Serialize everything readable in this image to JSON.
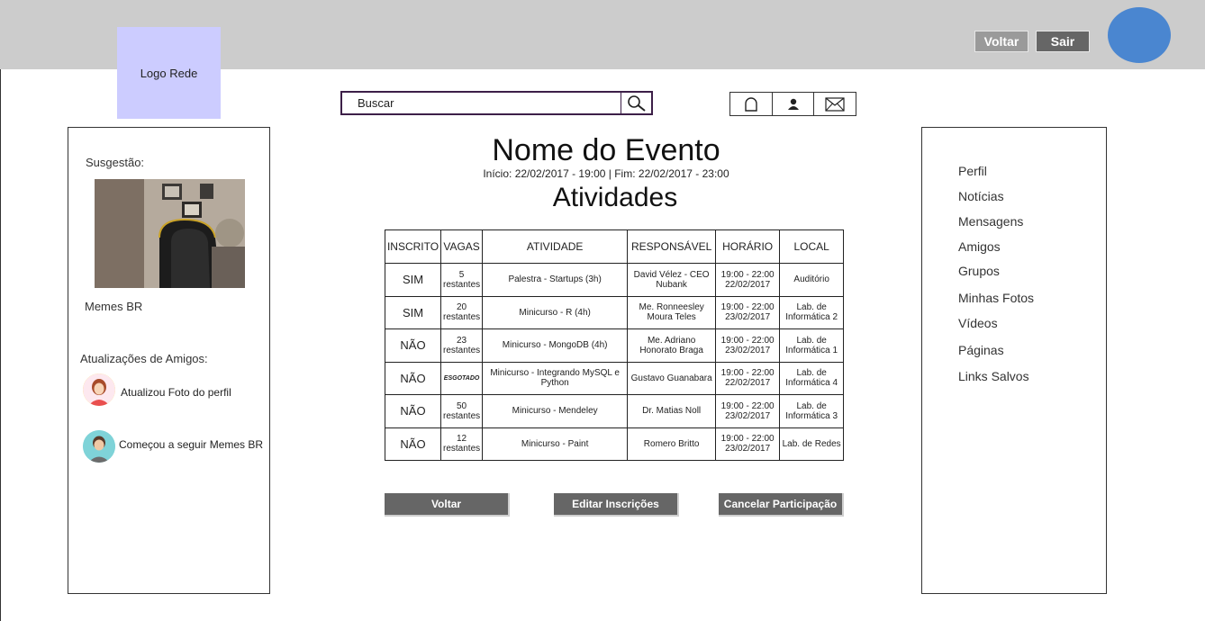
{
  "header": {
    "logo_text": "Logo Rede",
    "voltar_label": "Voltar",
    "sair_label": "Sair"
  },
  "search": {
    "placeholder": "Buscar",
    "icon": "search-icon"
  },
  "header_icons": [
    "bell-icon",
    "user-icon",
    "mail-icon"
  ],
  "left_panel": {
    "suggestion_label": "Susgestão:",
    "suggestion_name": "Memes BR",
    "updates_label": "Atualizações de Amigos:",
    "updates": [
      {
        "text": "Atualizou Foto do perfil",
        "avatar": "female-avatar"
      },
      {
        "text": "Começou a seguir Memes BR",
        "avatar": "male-avatar"
      }
    ]
  },
  "event": {
    "name": "Nome do Evento",
    "dates": "Início: 22/02/2017 - 19:00 | Fim: 22/02/2017 - 23:00",
    "section_title": "Atividades"
  },
  "table": {
    "headers": [
      "INSCRITO",
      "VAGAS",
      "ATIVIDADE",
      "RESPONSÁVEL",
      "HORÁRIO",
      "LOCAL"
    ],
    "rows": [
      {
        "inscrito": "SIM",
        "vagas_n": "5",
        "vagas_t": "restantes",
        "atividade": "Palestra - Startups (3h)",
        "responsavel": "David Vélez - CEO Nubank",
        "horario_h": "19:00 - 22:00",
        "horario_d": "22/02/2017",
        "local": "Auditório"
      },
      {
        "inscrito": "SIM",
        "vagas_n": "20",
        "vagas_t": "restantes",
        "atividade": "Minicurso - R (4h)",
        "responsavel": "Me. Ronneesley Moura Teles",
        "horario_h": "19:00 - 22:00",
        "horario_d": "23/02/2017",
        "local": "Lab. de Informática 2"
      },
      {
        "inscrito": "NÃO",
        "vagas_n": "23",
        "vagas_t": "restantes",
        "atividade": "Minicurso - MongoDB (4h)",
        "responsavel": "Me. Adriano Honorato Braga",
        "horario_h": "19:00 - 22:00",
        "horario_d": "23/02/2017",
        "local": "Lab. de Informática 1"
      },
      {
        "inscrito": "NÃO",
        "vagas_n": "ESGOTADO",
        "vagas_t": "",
        "atividade": "Minicurso - Integrando MySQL e Python",
        "responsavel": "Gustavo Guanabara",
        "horario_h": "19:00 - 22:00",
        "horario_d": "22/02/2017",
        "local": "Lab. de Informática 4"
      },
      {
        "inscrito": "NÃO",
        "vagas_n": "50",
        "vagas_t": "restantes",
        "atividade": "Minicurso - Mendeley",
        "responsavel": "Dr. Matias Noll",
        "horario_h": "19:00 - 22:00",
        "horario_d": "23/02/2017",
        "local": "Lab. de Informática 3"
      },
      {
        "inscrito": "NÃO",
        "vagas_n": "12",
        "vagas_t": "restantes",
        "atividade": "Minicurso - Paint",
        "responsavel": "Romero Britto",
        "horario_h": "19:00 - 22:00",
        "horario_d": "23/02/2017",
        "local": "Lab. de Redes"
      }
    ]
  },
  "actions": {
    "voltar": "Voltar",
    "editar": "Editar Inscrições",
    "cancelar": "Cancelar Participação"
  },
  "right_menu": [
    "Perfil",
    "Notícias",
    "Mensagens",
    "Amigos",
    "Grupos",
    "Minhas Fotos",
    "Vídeos",
    "Páginas",
    "Links Salvos"
  ],
  "colors": {
    "topbar": "#cccccc",
    "logo_bg": "#ccccff",
    "avatar_blue": "#4a86d0",
    "button_dark": "#666666",
    "button_light": "#9a9a9a"
  }
}
